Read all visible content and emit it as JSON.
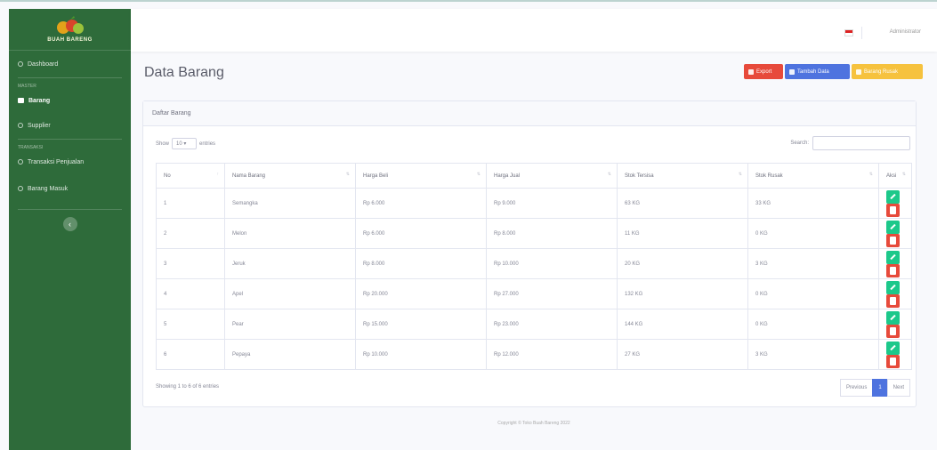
{
  "sidebar": {
    "brand": "BUAH BARENG",
    "items": [
      {
        "label": "Dashboard"
      },
      {
        "label": "Barang"
      },
      {
        "label": "Supplier"
      },
      {
        "label": "Transaksi Penjualan"
      },
      {
        "label": "Barang Masuk"
      }
    ],
    "headings": [
      "MASTER",
      "TRANSAKSI"
    ]
  },
  "topbar": {
    "username": "Administrator"
  },
  "page": {
    "title": "Data Barang",
    "export_label": "Export",
    "tambah_label": "Tambah Data",
    "rusak_label": "Barang Rusak"
  },
  "card": {
    "header": "Daftar Barang",
    "show_label": "Show",
    "show_value": "10",
    "entries_label": "entries",
    "search_label": "Search:",
    "columns": [
      "No",
      "Nama Barang",
      "Harga Beli",
      "Harga Jual",
      "Stok Tersisa",
      "Stok Rusak",
      "Aksi"
    ],
    "rows": [
      [
        "1",
        "Semangka",
        "Rp 6.000",
        "Rp 9.000",
        "63 KG",
        "33 KG"
      ],
      [
        "2",
        "Melon",
        "Rp 6.000",
        "Rp 8.000",
        "11 KG",
        "0 KG"
      ],
      [
        "3",
        "Jeruk",
        "Rp 8.000",
        "Rp 10.000",
        "20 KG",
        "3 KG"
      ],
      [
        "4",
        "Apel",
        "Rp 20.000",
        "Rp 27.000",
        "132 KG",
        "0 KG"
      ],
      [
        "5",
        "Pear",
        "Rp 15.000",
        "Rp 23.000",
        "144 KG",
        "0 KG"
      ],
      [
        "6",
        "Pepaya",
        "Rp 10.000",
        "Rp 12.000",
        "27 KG",
        "3 KG"
      ]
    ],
    "info": "Showing 1 to 6 of 6 entries",
    "prev": "Previous",
    "page": "1",
    "next": "Next"
  },
  "footer": "Copyright © Toko Buah Bareng 2022"
}
